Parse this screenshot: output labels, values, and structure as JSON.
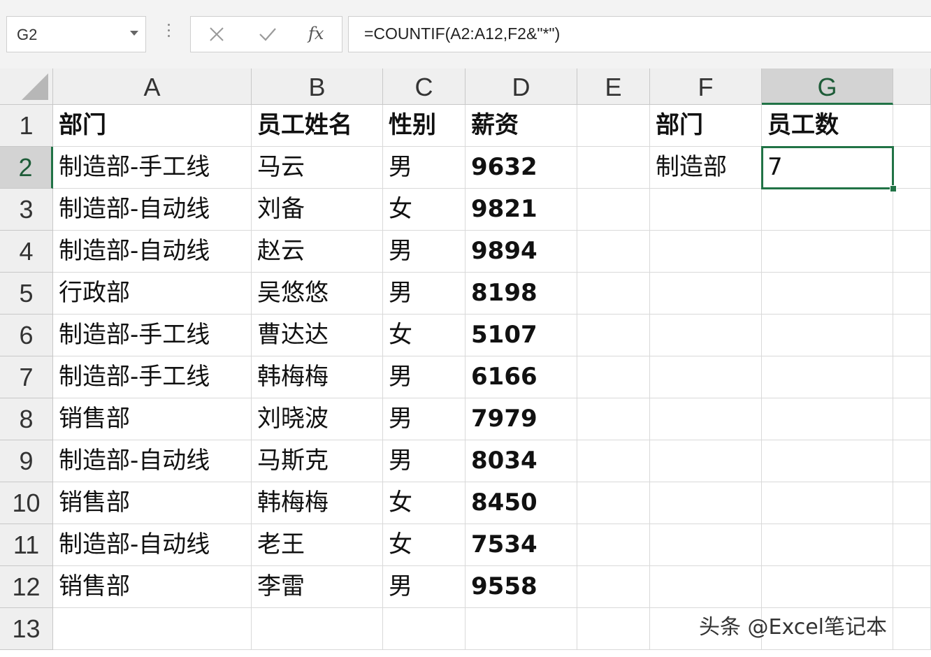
{
  "name_box": {
    "value": "G2",
    "dropdown_icon": "chevron-down-icon"
  },
  "formula_bar": {
    "cancel_icon": "close-icon",
    "confirm_icon": "check-icon",
    "insert_function_label": "fx",
    "formula": "=COUNTIF(A2:A12,F2&\"*\")"
  },
  "columns": [
    "A",
    "B",
    "C",
    "D",
    "E",
    "F",
    "G"
  ],
  "selected_column": "G",
  "selected_row": "2",
  "rows": [
    {
      "num": "1",
      "A": "部门",
      "B": "员工姓名",
      "C": "性别",
      "D": "薪资",
      "E": "",
      "F": "部门",
      "G": "员工数"
    },
    {
      "num": "2",
      "A": "制造部-手工线",
      "B": "马云",
      "C": "男",
      "D": "9632",
      "E": "",
      "F": "制造部",
      "G": "7"
    },
    {
      "num": "3",
      "A": "制造部-自动线",
      "B": "刘备",
      "C": "女",
      "D": "9821",
      "E": "",
      "F": "",
      "G": ""
    },
    {
      "num": "4",
      "A": "制造部-自动线",
      "B": "赵云",
      "C": "男",
      "D": "9894",
      "E": "",
      "F": "",
      "G": ""
    },
    {
      "num": "5",
      "A": "行政部",
      "B": "吴悠悠",
      "C": "男",
      "D": "8198",
      "E": "",
      "F": "",
      "G": ""
    },
    {
      "num": "6",
      "A": "制造部-手工线",
      "B": "曹达达",
      "C": "女",
      "D": "5107",
      "E": "",
      "F": "",
      "G": ""
    },
    {
      "num": "7",
      "A": "制造部-手工线",
      "B": "韩梅梅",
      "C": "男",
      "D": "6166",
      "E": "",
      "F": "",
      "G": ""
    },
    {
      "num": "8",
      "A": "销售部",
      "B": "刘晓波",
      "C": "男",
      "D": "7979",
      "E": "",
      "F": "",
      "G": ""
    },
    {
      "num": "9",
      "A": "制造部-自动线",
      "B": "马斯克",
      "C": "男",
      "D": "8034",
      "E": "",
      "F": "",
      "G": ""
    },
    {
      "num": "10",
      "A": "销售部",
      "B": "韩梅梅",
      "C": "女",
      "D": "8450",
      "E": "",
      "F": "",
      "G": ""
    },
    {
      "num": "11",
      "A": "制造部-自动线",
      "B": "老王",
      "C": "女",
      "D": "7534",
      "E": "",
      "F": "",
      "G": ""
    },
    {
      "num": "12",
      "A": "销售部",
      "B": "李雷",
      "C": "男",
      "D": "9558",
      "E": "",
      "F": "",
      "G": ""
    },
    {
      "num": "13",
      "A": "",
      "B": "",
      "C": "",
      "D": "",
      "E": "",
      "F": "",
      "G": ""
    }
  ],
  "watermark": "头条 @Excel笔记本",
  "colors": {
    "selection": "#217346",
    "header_bg": "#efefef",
    "grid_line": "#d9d9d9"
  }
}
